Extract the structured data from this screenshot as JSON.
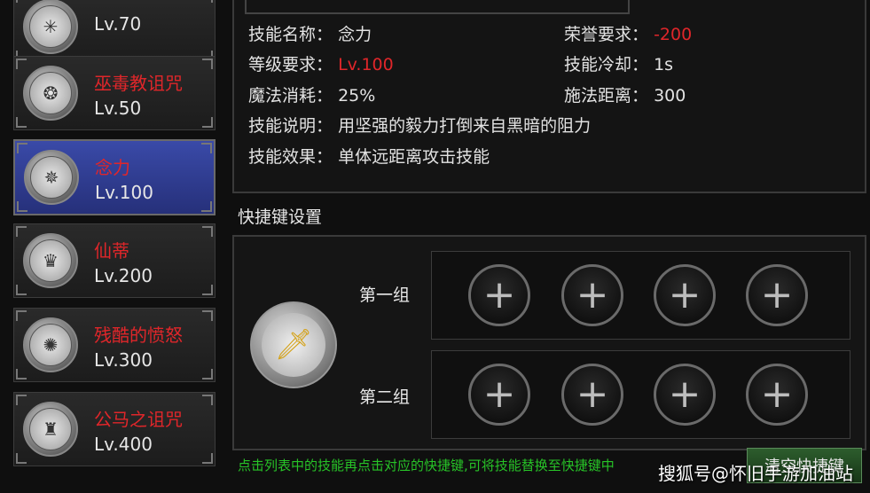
{
  "skills": [
    {
      "name": "",
      "level": "Lv.70",
      "glyph": "✳"
    },
    {
      "name": "巫毒教诅咒",
      "level": "Lv.50",
      "glyph": "❂"
    },
    {
      "name": "念力",
      "level": "Lv.100",
      "glyph": "✵"
    },
    {
      "name": "仙蒂",
      "level": "Lv.200",
      "glyph": "♛"
    },
    {
      "name": "残酷的愤怒",
      "level": "Lv.300",
      "glyph": "✺"
    },
    {
      "name": "公马之诅咒",
      "level": "Lv.400",
      "glyph": "♜"
    }
  ],
  "details": {
    "skill_name_label": "技能名称：",
    "skill_name_value": "念力",
    "honor_label": "荣誉要求：",
    "honor_value": "-200",
    "level_req_label": "等级要求：",
    "level_req_value": "Lv.100",
    "cooldown_label": "技能冷却：",
    "cooldown_value": "1s",
    "mana_label": "魔法消耗：",
    "mana_value": "25%",
    "range_label": "施法距离：",
    "range_value": "300",
    "desc_label": "技能说明：",
    "desc_value": "用坚强的毅力打倒来自黑暗的阻力",
    "effect_label": "技能效果：",
    "effect_value": "单体远距离攻击技能"
  },
  "hotkeys": {
    "title": "快捷键设置",
    "group1_label": "第一组",
    "group2_label": "第二组",
    "slot_glyph": "+",
    "current_skill_glyph": "🗡",
    "hint": "点击列表中的技能再点击对应的快捷键,可将技能替换至快捷键中",
    "clear_button": "清空快捷键"
  },
  "watermark": "搜狐号@怀旧手游加油站",
  "colors": {
    "accent_red": "#e0262a",
    "hint_green": "#27c327",
    "selected_bg": "#2f3c95"
  }
}
